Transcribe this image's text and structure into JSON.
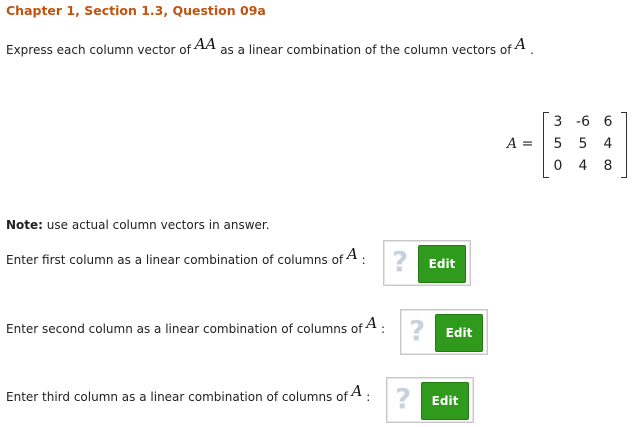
{
  "header": {
    "title": "Chapter 1, Section 1.3, Question 09a"
  },
  "question": {
    "text_before": "Express each column vector of",
    "math_aa": "AA",
    "text_middle": "as a linear combination of the column vectors of",
    "math_a": "A",
    "text_end": "."
  },
  "matrix": {
    "name": "A",
    "equals": "=",
    "rows": [
      [
        "3",
        "-6",
        "6"
      ],
      [
        "5",
        "5",
        "4"
      ],
      [
        "0",
        "4",
        "8"
      ]
    ]
  },
  "note": {
    "label": "Note:",
    "text": "use actual column vectors in answer."
  },
  "prompts": [
    {
      "text": "Enter first column as a linear combination of columns of",
      "math": "A",
      "colon": ":",
      "placeholder": "?",
      "button": "Edit"
    },
    {
      "text": "Enter second column as a linear combination of columns of",
      "math": "A",
      "colon": ":",
      "placeholder": "?",
      "button": "Edit"
    },
    {
      "text": "Enter third column as a linear combination of columns of",
      "math": "A",
      "colon": ":",
      "placeholder": "?",
      "button": "Edit"
    }
  ]
}
